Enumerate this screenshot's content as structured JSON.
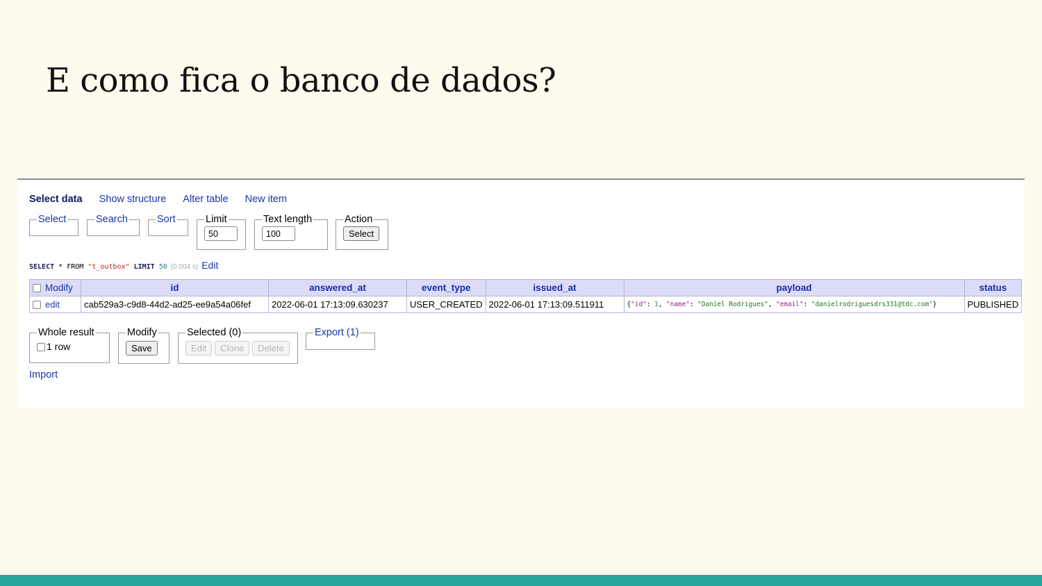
{
  "slide": {
    "title": "E como fica o banco de dados?"
  },
  "nav": {
    "select_data": "Select data",
    "show_structure": "Show structure",
    "alter_table": "Alter table",
    "new_item": "New item"
  },
  "controls": {
    "select": "Select",
    "search": "Search",
    "sort": "Sort",
    "limit_label": "Limit",
    "limit_value": "50",
    "text_length_label": "Text length",
    "text_length_value": "100",
    "action_label": "Action",
    "action_button": "Select"
  },
  "sql": {
    "select_kw": "SELECT",
    "star": " * ",
    "from_kw": "FROM",
    "table": "\"t_outbox\"",
    "limit_kw": "LIMIT",
    "limit_num": "50",
    "time": "(0.004 s)",
    "edit": "Edit"
  },
  "table": {
    "modify_header": "Modify",
    "columns": [
      "id",
      "answered_at",
      "event_type",
      "issued_at",
      "payload",
      "status"
    ],
    "row": {
      "edit": "edit",
      "id": "cab529a3-c9d8-44d2-ad25-ee9a54a06fef",
      "answered_at": "2022-06-01 17:13:09.630237",
      "event_type": "USER_CREATED",
      "issued_at": "2022-06-01 17:13:09.511911",
      "payload": {
        "open": "{",
        "k1": "\"id\"",
        "v1": "1",
        "k2": "\"name\"",
        "v2": "\"Daniel Rodrigues\"",
        "k3": "\"email\"",
        "v3": "\"danielrodriguesdrs331@tdc.com\"",
        "close": "}"
      },
      "status": "PUBLISHED"
    }
  },
  "bottom": {
    "whole_result_label": "Whole result",
    "row_count": "1 row",
    "modify_label": "Modify",
    "save": "Save",
    "selected_label": "Selected (0)",
    "edit": "Edit",
    "clone": "Clone",
    "delete": "Delete",
    "export_label": "Export (1)",
    "import": "Import"
  },
  "colors": {
    "background": "#fefaee",
    "accent_bar": "#26a69a",
    "link": "#1a37a8",
    "header_bg": "#dcdcf9"
  }
}
